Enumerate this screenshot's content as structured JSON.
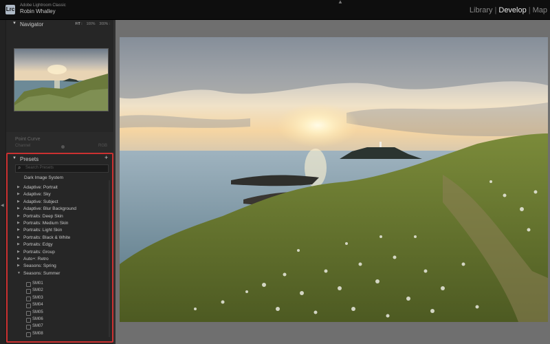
{
  "app": {
    "logo": "Lrc",
    "name": "Adobe Lightroom Classic",
    "user": "Robin Whalley"
  },
  "modules": [
    {
      "label": "Library",
      "active": false
    },
    {
      "label": "Develop",
      "active": true
    },
    {
      "label": "Map",
      "active": false
    }
  ],
  "navigator": {
    "title": "Navigator",
    "zoom": [
      "FIT :",
      "100%",
      "300% :"
    ]
  },
  "point_curve_panel": {
    "title": "Point Curve",
    "label": "Channel",
    "value": "RGB"
  },
  "presets": {
    "title": "Presets",
    "add": "+",
    "search_placeholder": "Search Presets",
    "groups": [
      {
        "label": "Dark Image System",
        "expanded": false
      },
      {
        "label": "Adaptive: Portrait",
        "expanded": false
      },
      {
        "label": "Adaptive: Sky",
        "expanded": false
      },
      {
        "label": "Adaptive: Subject",
        "expanded": false
      },
      {
        "label": "Adaptive: Blur Background",
        "expanded": false
      },
      {
        "label": "Portraits: Deep Skin",
        "expanded": false
      },
      {
        "label": "Portraits: Medium Skin",
        "expanded": false
      },
      {
        "label": "Portraits: Light Skin",
        "expanded": false
      },
      {
        "label": "Portraits: Black & White",
        "expanded": false
      },
      {
        "label": "Portraits: Edgy",
        "expanded": false
      },
      {
        "label": "Portraits: Group",
        "expanded": false
      },
      {
        "label": "Auto+: Retro",
        "expanded": false
      },
      {
        "label": "Seasons: Spring",
        "expanded": false
      },
      {
        "label": "Seasons: Summer",
        "expanded": true
      }
    ],
    "summer_items": [
      "SM01",
      "SM02",
      "SM03",
      "SM04",
      "SM05",
      "SM06",
      "SM07",
      "SM08"
    ]
  },
  "icons": {
    "panel_expand": "triangle-down-icon",
    "group_collapsed": "triangle-right-icon",
    "search": "search-icon",
    "preset_item": "preset-icon"
  },
  "colors": {
    "highlight_box": "#cc3131",
    "active_module": "#e8e8e8"
  }
}
